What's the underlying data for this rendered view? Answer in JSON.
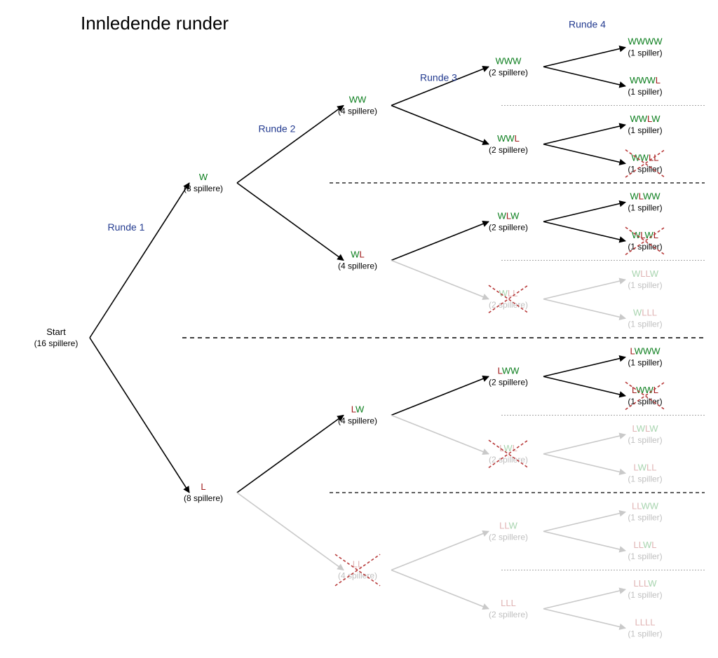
{
  "title": "Innledende runder",
  "round_labels": [
    "Runde 1",
    "Runde 2",
    "Runde 3",
    "Runde 4"
  ],
  "start": {
    "label": "Start",
    "sub": "(16 spillere)"
  },
  "colors": {
    "win": "#0a7d1c",
    "loss": "#a11c1c",
    "elim": "#bfbfbf"
  },
  "subs": {
    "p8": "(8 spillere)",
    "p4": "(4 spillere)",
    "p2": "(2 spillere)",
    "p1": "(1 spiller)"
  },
  "nodes": {
    "W": {
      "seq": "W",
      "sub": "p8",
      "elim": false,
      "cross": false
    },
    "L": {
      "seq": "L",
      "sub": "p8",
      "elim": false,
      "cross": false
    },
    "WW": {
      "seq": "WW",
      "sub": "p4",
      "elim": false,
      "cross": false
    },
    "WL": {
      "seq": "WL",
      "sub": "p4",
      "elim": false,
      "cross": false
    },
    "LW": {
      "seq": "LW",
      "sub": "p4",
      "elim": false,
      "cross": false
    },
    "LL": {
      "seq": "LL",
      "sub": "p4",
      "elim": true,
      "cross": true
    },
    "WWW": {
      "seq": "WWW",
      "sub": "p2",
      "elim": false,
      "cross": false
    },
    "WWL": {
      "seq": "WWL",
      "sub": "p2",
      "elim": false,
      "cross": false
    },
    "WLW": {
      "seq": "WLW",
      "sub": "p2",
      "elim": false,
      "cross": false
    },
    "WLL": {
      "seq": "WLL",
      "sub": "p2",
      "elim": true,
      "cross": true
    },
    "LWW": {
      "seq": "LWW",
      "sub": "p2",
      "elim": false,
      "cross": false
    },
    "LWL": {
      "seq": "LWL",
      "sub": "p2",
      "elim": true,
      "cross": true
    },
    "LLW": {
      "seq": "LLW",
      "sub": "p2",
      "elim": true,
      "cross": false
    },
    "LLL": {
      "seq": "LLL",
      "sub": "p2",
      "elim": true,
      "cross": false
    },
    "WWWW": {
      "seq": "WWWW",
      "sub": "p1",
      "elim": false,
      "cross": false
    },
    "WWWL": {
      "seq": "WWWL",
      "sub": "p1",
      "elim": false,
      "cross": false
    },
    "WWLW": {
      "seq": "WWLW",
      "sub": "p1",
      "elim": false,
      "cross": false
    },
    "WWLL": {
      "seq": "WWLL",
      "sub": "p1",
      "elim": false,
      "cross": true
    },
    "WLWW": {
      "seq": "WLWW",
      "sub": "p1",
      "elim": false,
      "cross": false
    },
    "WLWL": {
      "seq": "WLWL",
      "sub": "p1",
      "elim": false,
      "cross": true
    },
    "WLLW": {
      "seq": "WLLW",
      "sub": "p1",
      "elim": true,
      "cross": false
    },
    "WLLL": {
      "seq": "WLLL",
      "sub": "p1",
      "elim": true,
      "cross": false
    },
    "LWWW": {
      "seq": "LWWW",
      "sub": "p1",
      "elim": false,
      "cross": false
    },
    "LWWL": {
      "seq": "LWWL",
      "sub": "p1",
      "elim": false,
      "cross": true
    },
    "LWLW": {
      "seq": "LWLW",
      "sub": "p1",
      "elim": true,
      "cross": false
    },
    "LWLL": {
      "seq": "LWLL",
      "sub": "p1",
      "elim": true,
      "cross": false
    },
    "LLWW": {
      "seq": "LLWW",
      "sub": "p1",
      "elim": true,
      "cross": false
    },
    "LLWL": {
      "seq": "LLWL",
      "sub": "p1",
      "elim": true,
      "cross": false
    },
    "LLLW": {
      "seq": "LLLW",
      "sub": "p1",
      "elim": true,
      "cross": false
    },
    "LLLL": {
      "seq": "LLLL",
      "sub": "p1",
      "elim": true,
      "cross": false
    }
  },
  "edges": [
    {
      "from": "START",
      "to": "W"
    },
    {
      "from": "START",
      "to": "L"
    },
    {
      "from": "W",
      "to": "WW"
    },
    {
      "from": "W",
      "to": "WL"
    },
    {
      "from": "L",
      "to": "LW"
    },
    {
      "from": "L",
      "to": "LL"
    },
    {
      "from": "WW",
      "to": "WWW"
    },
    {
      "from": "WW",
      "to": "WWL"
    },
    {
      "from": "WL",
      "to": "WLW"
    },
    {
      "from": "WL",
      "to": "WLL"
    },
    {
      "from": "LW",
      "to": "LWW"
    },
    {
      "from": "LW",
      "to": "LWL"
    },
    {
      "from": "LL",
      "to": "LLW"
    },
    {
      "from": "LL",
      "to": "LLL"
    },
    {
      "from": "WWW",
      "to": "WWWW"
    },
    {
      "from": "WWW",
      "to": "WWWL"
    },
    {
      "from": "WWL",
      "to": "WWLW"
    },
    {
      "from": "WWL",
      "to": "WWLL"
    },
    {
      "from": "WLW",
      "to": "WLWW"
    },
    {
      "from": "WLW",
      "to": "WLWL"
    },
    {
      "from": "WLL",
      "to": "WLLW"
    },
    {
      "from": "WLL",
      "to": "WLLL"
    },
    {
      "from": "LWW",
      "to": "LWWW"
    },
    {
      "from": "LWW",
      "to": "LWWL"
    },
    {
      "from": "LWL",
      "to": "LWLW"
    },
    {
      "from": "LWL",
      "to": "LWLL"
    },
    {
      "from": "LLW",
      "to": "LLWW"
    },
    {
      "from": "LLW",
      "to": "LLWL"
    },
    {
      "from": "LLL",
      "to": "LLLW"
    },
    {
      "from": "LLL",
      "to": "LLLL"
    }
  ]
}
